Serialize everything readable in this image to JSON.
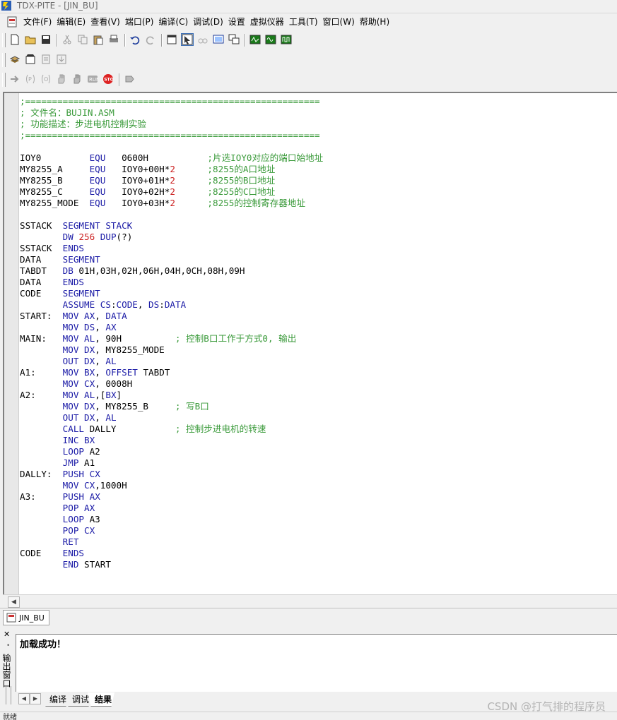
{
  "window": {
    "title": "TDX-PITE - [JIN_BU]"
  },
  "menu": [
    "文件(F)",
    "编辑(E)",
    "查看(V)",
    "端口(P)",
    "编译(C)",
    "调试(D)",
    "设置",
    "虚拟仪器",
    "工具(T)",
    "窗口(W)",
    "帮助(H)"
  ],
  "toolbar1": [
    "new-file-icon",
    "open-folder-icon",
    "save-icon",
    "cut-icon",
    "copy-icon",
    "paste-icon",
    "print-icon",
    "undo-icon",
    "redo-icon",
    "window-icon",
    "pointer-icon",
    "binoculars-icon",
    "monitor-icon",
    "cascade-icon",
    "scope-icon",
    "wave-icon",
    "logic-icon"
  ],
  "toolbar2": [
    "compile-icon",
    "build-icon",
    "download-icon",
    "load-icon"
  ],
  "toolbar3": [
    "step-icon",
    "step-into-icon",
    "step-over-icon",
    "hand-icon",
    "breakpoint-icon",
    "run-icon",
    "stop-icon",
    "reset-icon"
  ],
  "editor": {
    "lines": [
      ";=======================================================",
      "; 文件名：BUJIN.ASM",
      "; 功能描述：步进电机控制实验",
      ";=======================================================",
      "",
      "IOY0         EQU   0600H           ;片选IOY0对应的端口始地址",
      "MY8255_A     EQU   IOY0+00H*2      ;8255的A口地址",
      "MY8255_B     EQU   IOY0+01H*2      ;8255的B口地址",
      "MY8255_C     EQU   IOY0+02H*2      ;8255的C口地址",
      "MY8255_MODE  EQU   IOY0+03H*2      ;8255的控制寄存器地址",
      "",
      "SSTACK  SEGMENT STACK",
      "        DW 256 DUP(?)",
      "SSTACK  ENDS",
      "DATA    SEGMENT",
      "TABDT   DB 01H,03H,02H,06H,04H,0CH,08H,09H",
      "DATA    ENDS",
      "CODE    SEGMENT",
      "        ASSUME CS:CODE, DS:DATA",
      "START:  MOV AX, DATA",
      "        MOV DS, AX",
      "MAIN:   MOV AL, 90H          ; 控制B口工作于方式0, 输出",
      "        MOV DX, MY8255_MODE",
      "        OUT DX, AL",
      "A1:     MOV BX, OFFSET TABDT",
      "        MOV CX, 0008H",
      "A2:     MOV AL,[BX]",
      "        MOV DX, MY8255_B     ; 写B口",
      "        OUT DX, AL",
      "        CALL DALLY           ; 控制步进电机的转速",
      "        INC BX",
      "        LOOP A2",
      "        JMP A1",
      "DALLY:  PUSH CX",
      "        MOV CX,1000H",
      "A3:     PUSH AX",
      "        POP AX",
      "        LOOP A3",
      "        POP CX",
      "        RET",
      "CODE    ENDS",
      "        END START"
    ]
  },
  "doc_tab": {
    "label": "JIN_BU"
  },
  "output": {
    "side_label": "输出窗口",
    "message": "加载成功！",
    "tabs": [
      "编译",
      "调试",
      "结果"
    ],
    "active_tab": "结果"
  },
  "watermark": "CSDN @打气排的程序员",
  "status": "就绪",
  "colors": {
    "comment": "#3a9a3a",
    "keyword": "#1a1aa6",
    "number": "#cc2222"
  }
}
